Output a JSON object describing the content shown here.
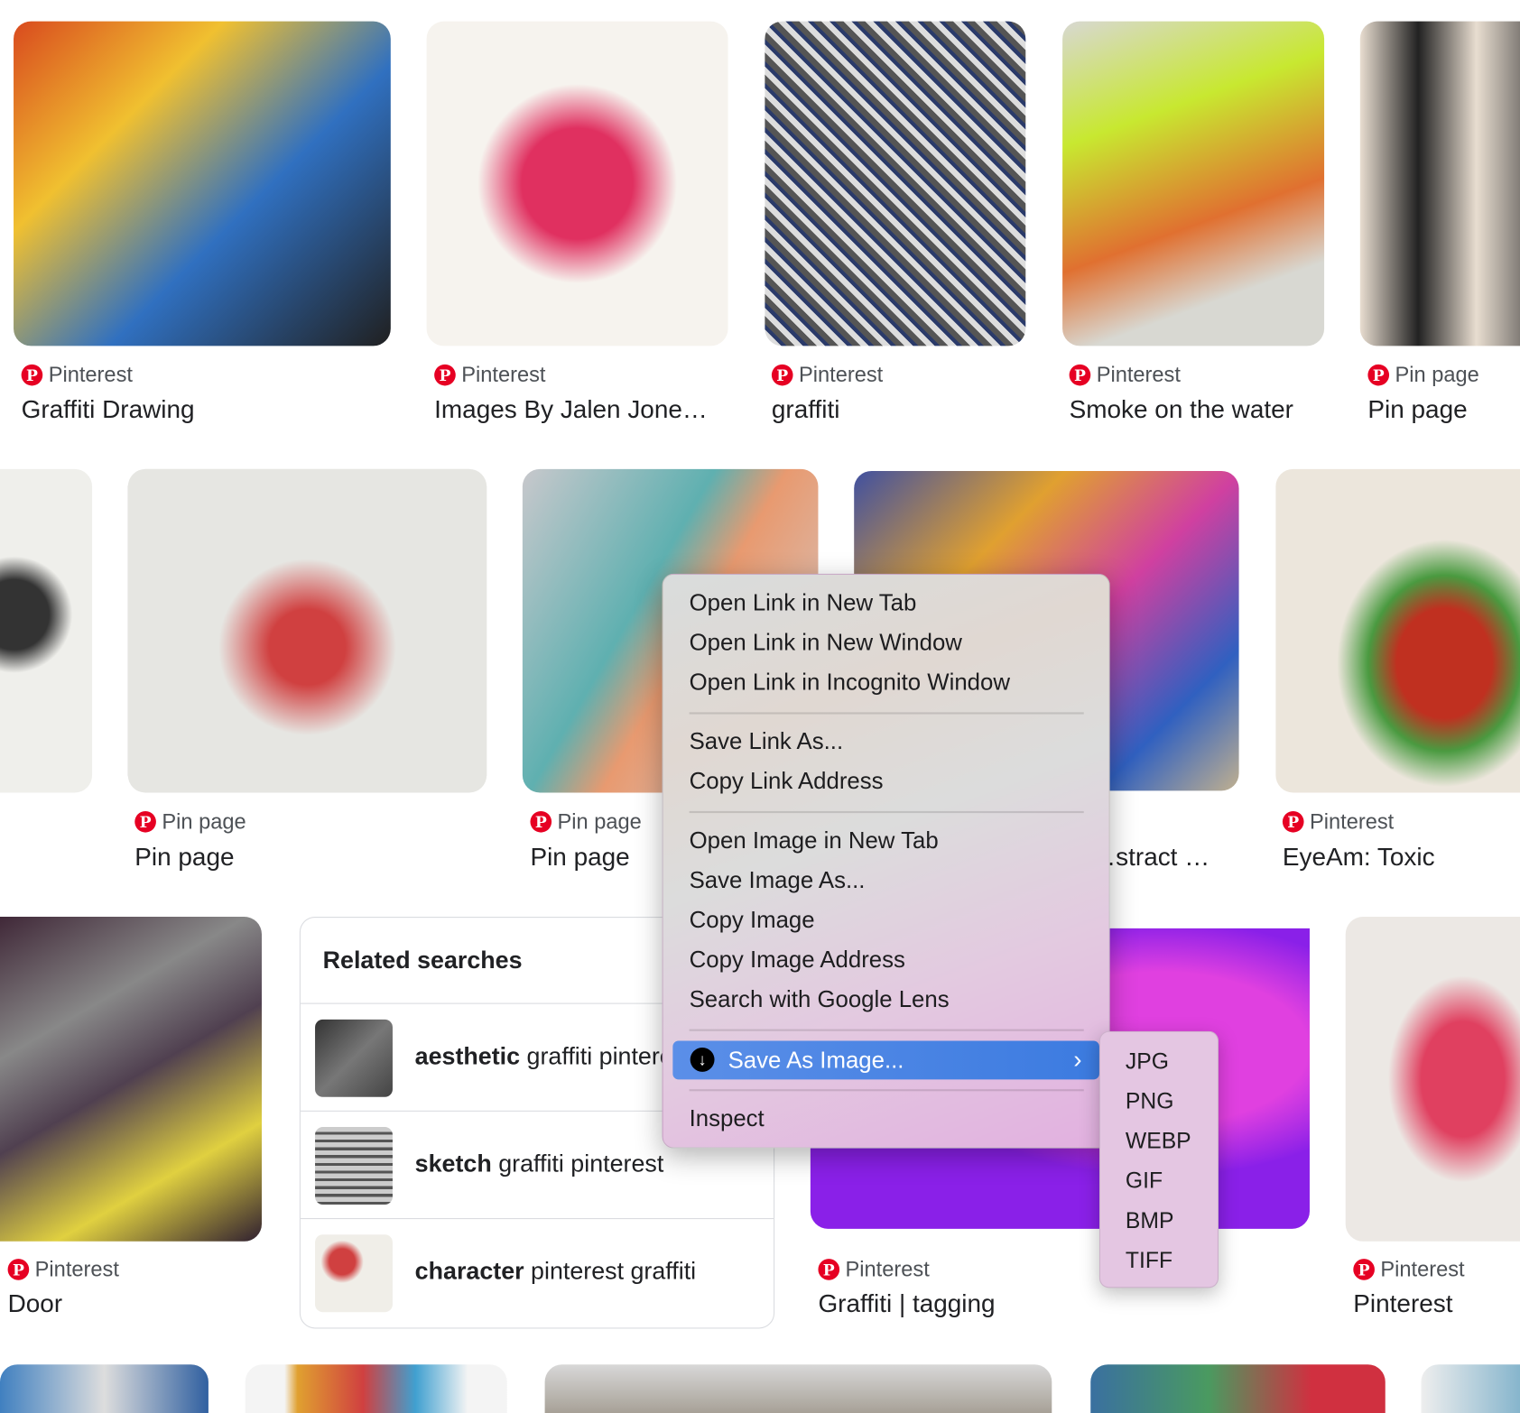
{
  "results": [
    {
      "source": "Pinterest",
      "title": "Graffiti Drawing",
      "color": "#c0522a"
    },
    {
      "source": "Pinterest",
      "title": "Images By Jalen Jone…",
      "color": "#e03060"
    },
    {
      "source": "Pinterest",
      "title": "graffiti",
      "color": "#6b6b6b"
    },
    {
      "source": "Pinterest",
      "title": "Smoke on the water",
      "color": "#c8e830"
    },
    {
      "source": "Pin page",
      "title": "Pin page",
      "color": "#8a7a6a"
    },
    {
      "source": "",
      "title": "",
      "color": "#e8e8e4"
    },
    {
      "source": "Pin page",
      "title": "Pin page",
      "color": "#d04040"
    },
    {
      "source": "Pin page",
      "title": "Pin page",
      "color": "#5fb0b0"
    },
    {
      "source": "",
      "title": "…stract …",
      "color": "#4050a0"
    },
    {
      "source": "Pinterest",
      "title": "EyeAm: Toxic",
      "color": "#4a9a40"
    },
    {
      "source": "Pinterest",
      "title": "Door",
      "color": "#504050"
    },
    {
      "source": "Pinterest",
      "title": "Graffiti | tagging",
      "color": "#a020e0"
    },
    {
      "source": "Pinterest",
      "title": "Pinterest",
      "color": "#e04060"
    }
  ],
  "related": {
    "heading": "Related searches",
    "items": [
      {
        "bold": "aesthetic",
        "rest": " graffiti pinterest"
      },
      {
        "bold": "sketch",
        "rest": " graffiti pinterest"
      },
      {
        "bold": "character",
        "rest": " pinterest graffiti"
      }
    ]
  },
  "context_menu": {
    "items": [
      "Open Link in New Tab",
      "Open Link in New Window",
      "Open Link in Incognito Window",
      "Save Link As...",
      "Copy Link Address",
      "Open Image in New Tab",
      "Save Image As...",
      "Copy Image",
      "Copy Image Address",
      "Search with Google Lens",
      "Save As Image...",
      "Inspect"
    ],
    "highlighted": "Save As Image...",
    "highlight_color": "#3c7be0",
    "submenu": [
      "JPG",
      "PNG",
      "WEBP",
      "GIF",
      "BMP",
      "TIFF"
    ]
  }
}
